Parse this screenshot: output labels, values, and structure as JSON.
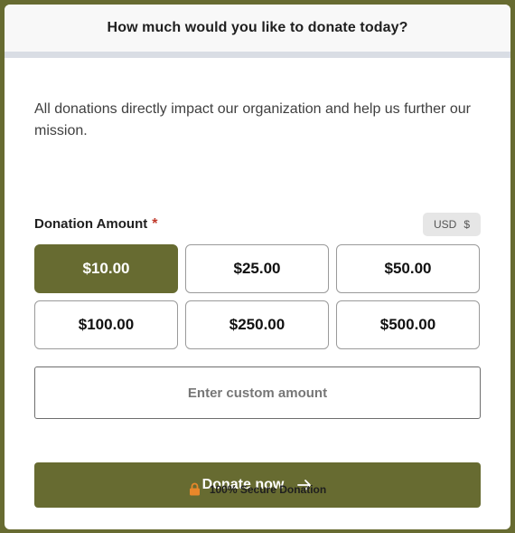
{
  "header": {
    "title": "How much would you like to donate today?"
  },
  "intro": {
    "text": "All donations directly impact our organization and help us further our mission."
  },
  "amount_section": {
    "label": "Donation Amount",
    "required_mark": "*",
    "currency_code": "USD",
    "currency_symbol": "$"
  },
  "amounts": [
    {
      "label": "$10.00",
      "selected": true
    },
    {
      "label": "$25.00",
      "selected": false
    },
    {
      "label": "$50.00",
      "selected": false
    },
    {
      "label": "$100.00",
      "selected": false
    },
    {
      "label": "$250.00",
      "selected": false
    },
    {
      "label": "$500.00",
      "selected": false
    }
  ],
  "custom_amount": {
    "placeholder": "Enter custom amount",
    "value": ""
  },
  "donate_button": {
    "label": "Donate now",
    "icon": "arrow-right-icon"
  },
  "secure": {
    "text": "100% Secure Donation",
    "icon": "lock-icon"
  },
  "colors": {
    "accent": "#676b31",
    "lock": "#e8872a",
    "header_bar": "#d9dde4",
    "required": "#c0392b"
  }
}
